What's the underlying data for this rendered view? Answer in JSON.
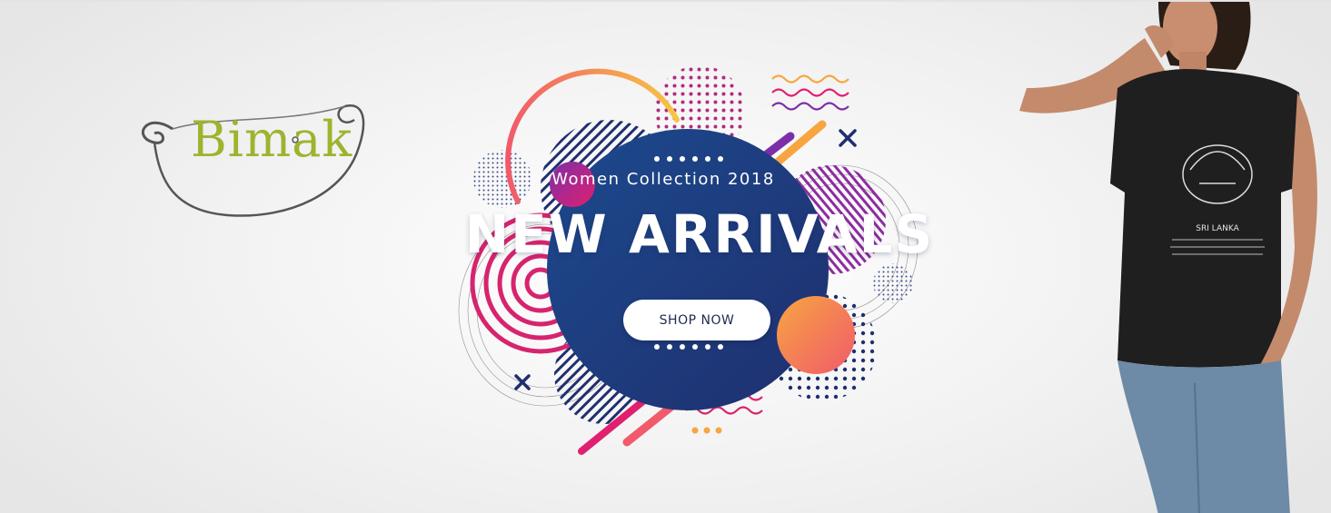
{
  "brand": {
    "logo_text": "Bimak",
    "logo_color": "#9fb32f"
  },
  "hero": {
    "subtitle": "Women Collection 2018",
    "headline": "NEW ARRIVALS",
    "cta_label": "SHOP NOW"
  },
  "model_photo": {
    "tshirt_print_caption": "SRI LANKA"
  },
  "colors": {
    "circle_navy": "#1f3a7a",
    "accent_magenta": "#d6246e",
    "accent_orange": "#f7a541",
    "accent_purple": "#7b2fa8"
  }
}
